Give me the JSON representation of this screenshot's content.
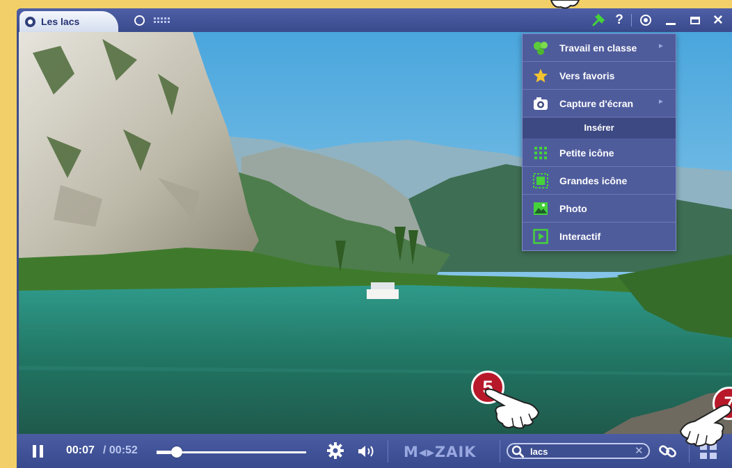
{
  "window": {
    "title": "Les lacs",
    "icons": [
      "mozaik-logo-icon",
      "360-view-icon",
      "dots-grid-icon",
      "pin-icon",
      "help-icon",
      "eye-icon",
      "minimize-icon",
      "maximize-icon",
      "close-icon"
    ],
    "help_glyph": "?",
    "close_glyph": "✕"
  },
  "menu": {
    "items": [
      {
        "label": "Travail en classe",
        "icon": "classwork-icon",
        "submenu": true
      },
      {
        "label": "Vers favoris",
        "icon": "star-icon",
        "submenu": false
      },
      {
        "label": "Capture d'écran",
        "icon": "camera-icon",
        "submenu": true
      }
    ],
    "section_header": "Insérer",
    "insert_items": [
      {
        "label": "Petite icône",
        "icon": "small-icon-grid-icon"
      },
      {
        "label": "Grandes icône",
        "icon": "large-icon-icon"
      },
      {
        "label": "Photo",
        "icon": "photo-icon"
      },
      {
        "label": "Interactif",
        "icon": "interactive-play-icon"
      }
    ],
    "arrow_glyph": "►"
  },
  "controls": {
    "current_time": "00:07",
    "duration": "/ 00:52",
    "progress": 0.135,
    "logo_text": "M◂▸ZAIK",
    "search_value": "lacs",
    "search_clear": "✕"
  },
  "overlays": {
    "badge_5": "5",
    "badge_7": "7"
  },
  "colors": {
    "frame": "#3b4c8e",
    "menu_bg": "#4f5c9c",
    "accent_green": "#45d23a",
    "badge_red": "#b8192a",
    "page_bg": "#f3cf69"
  }
}
